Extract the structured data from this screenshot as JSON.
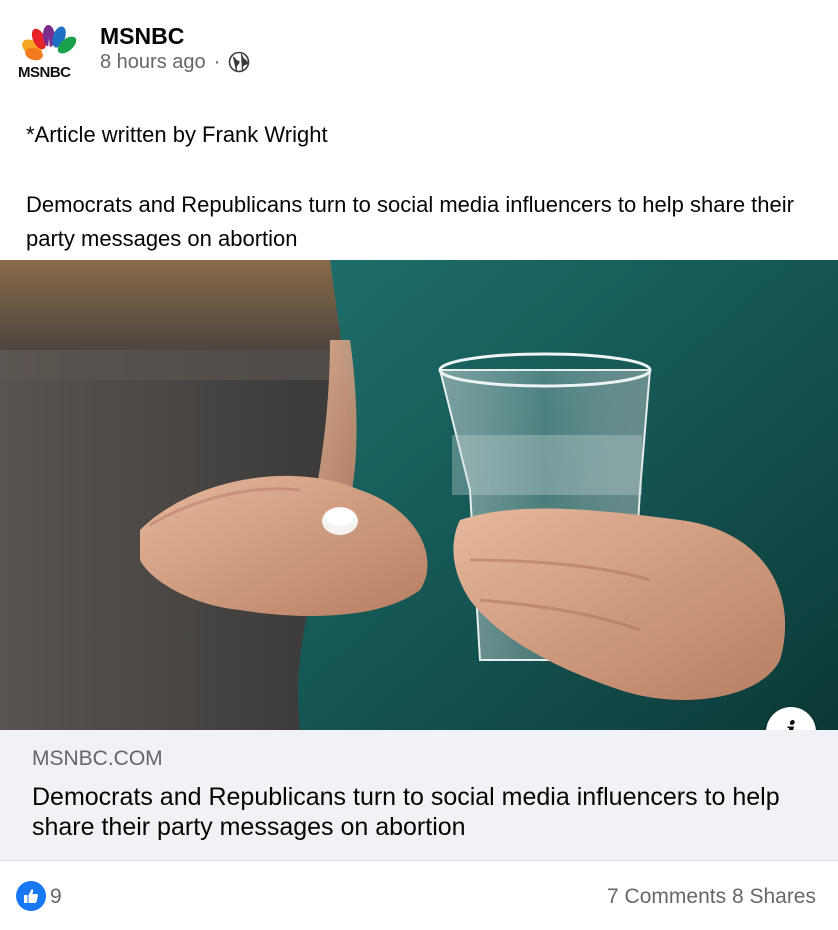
{
  "post": {
    "page_name": "MSNBC",
    "avatar_text": "MSNBC",
    "timestamp": "8 hours ago",
    "separator": "·",
    "privacy_icon": "globe-icon",
    "author_line": "*Article written by Frank Wright",
    "body": "Democrats and Republicans turn to social media influencers to help share their party messages on abortion"
  },
  "link_preview": {
    "domain": "MSNBC.COM",
    "title": "Democrats and Republicans turn to social media influencers to help share their party messages on abortion",
    "info_icon": "info-icon",
    "info_label": "i"
  },
  "footer": {
    "reaction_icon": "like-icon",
    "reaction_count": "9",
    "comments": "7 Comments",
    "shares": "8 Shares"
  },
  "colors": {
    "like_blue": "#1877f2",
    "secondary_text": "#65676b",
    "link_bg": "#f0f2f5"
  }
}
